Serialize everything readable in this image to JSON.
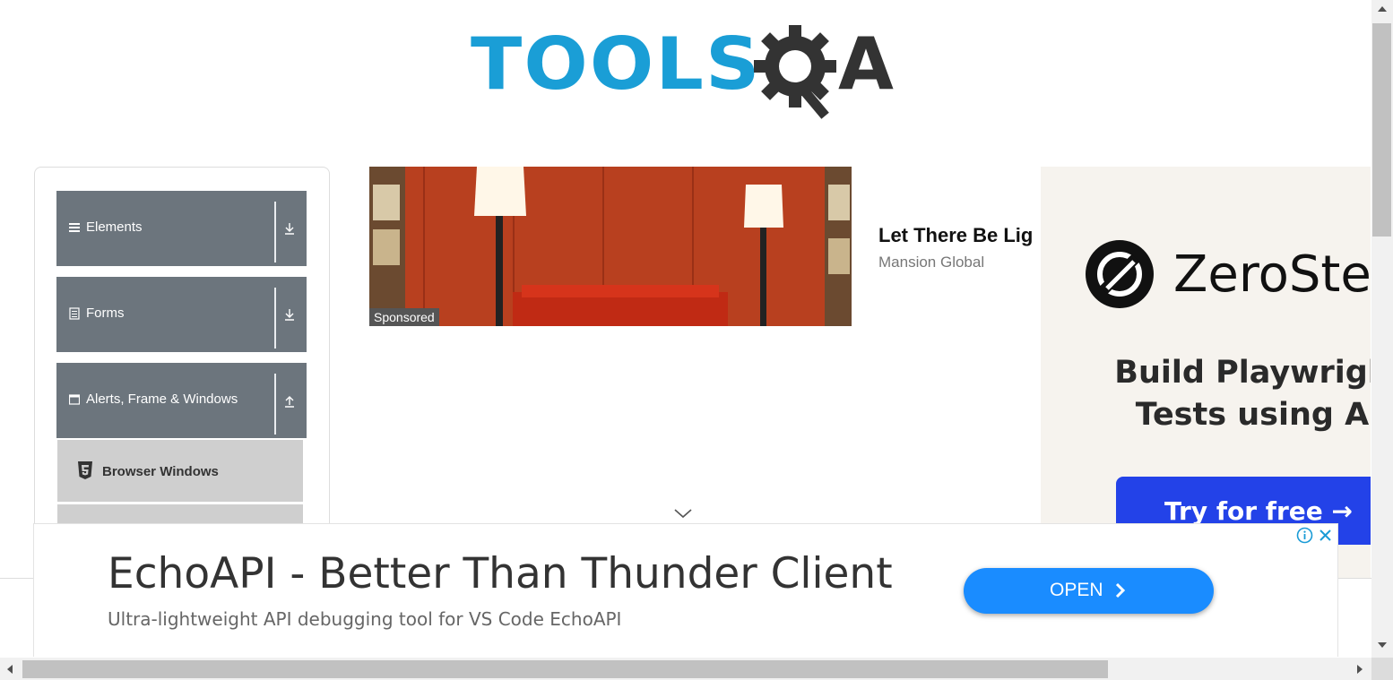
{
  "logo": {
    "tools_text": "TOOLS",
    "a_text": "A",
    "tools_color": "#1a9ed6",
    "dark_color": "#333333"
  },
  "sidebar": {
    "groups": [
      {
        "label": "Elements",
        "icon": "hamburger-icon",
        "arrow": "download-arrow-icon"
      },
      {
        "label": "Forms",
        "icon": "document-icon",
        "arrow": "download-arrow-icon"
      },
      {
        "label": "Alerts, Frame & Windows",
        "icon": "window-icon",
        "arrow": "upload-arrow-icon"
      }
    ],
    "active_item": {
      "label": "Browser Windows",
      "icon": "html5-icon"
    }
  },
  "sponsored_ad": {
    "tag": "Sponsored",
    "headline": "Let There Be Lig",
    "source": "Mansion Global"
  },
  "zerostep_ad": {
    "brand": "ZeroSte",
    "line1": "Build Playwrigh",
    "line2": "Tests using A",
    "button": "Try for free →"
  },
  "banner_ad": {
    "title": "EchoAPI - Better Than Thunder Client",
    "subtitle": "Ultra-lightweight API debugging tool for VS Code EchoAPI",
    "open_label": "OPEN",
    "open_color": "#1a8cff"
  },
  "colors": {
    "sidebar_group": "#6c757d",
    "active_item": "#cfcfcf"
  }
}
